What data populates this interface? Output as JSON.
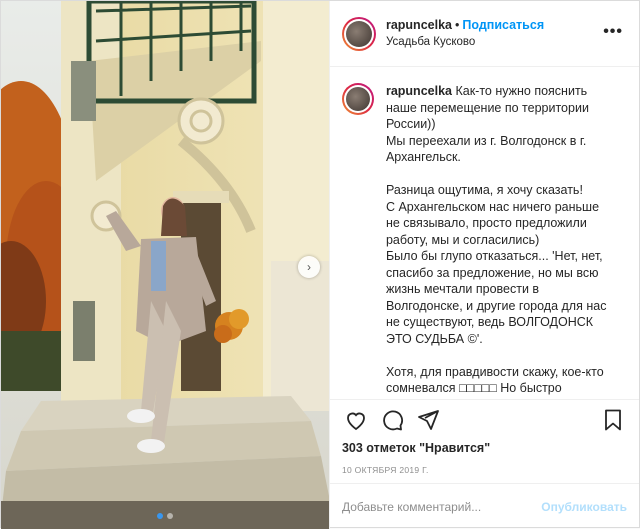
{
  "post": {
    "username": "rapuncelka",
    "separator": "•",
    "follow_label": "Подписаться",
    "location": "Усадьба Кусково",
    "more_icon": "more-options-icon",
    "caption_username": "rapuncelka",
    "caption_text": " Как-то нужно пояснить наше перемещение по территории России))\nМы переехали из г. Волгодонск в г. Архангельск.\n\nРазница ощутима, я хочу сказать!\nС Архангельском нас ничего раньше не связывало, просто предложили работу, мы и согласились)\nБыло бы глупо отказаться... 'Нет, нет, спасибо за предложение, но мы всю жизнь мечтали провести в Волгодонске, и другие города для нас не существуют, ведь ВОЛГОДОНСК ЭТО СУДЬБА ©'.\n\nХотя, для правдивости скажу, кое-кто сомневался □□□□□ Но быстро образумился)) И вот, мы уже",
    "likes_text": "303 отметок \"Нравится\"",
    "date": "10 ОКТЯБРЯ 2019 Г.",
    "comment_placeholder": "Добавьте комментарий...",
    "publish_label": "Опубликовать",
    "carousel_next": "›",
    "icons": [
      "heart-icon",
      "comment-icon",
      "share-icon",
      "bookmark-icon"
    ]
  },
  "colors": {
    "accent": "#0095f6",
    "border": "#dbdbdb",
    "muted": "#8e8e8e"
  }
}
